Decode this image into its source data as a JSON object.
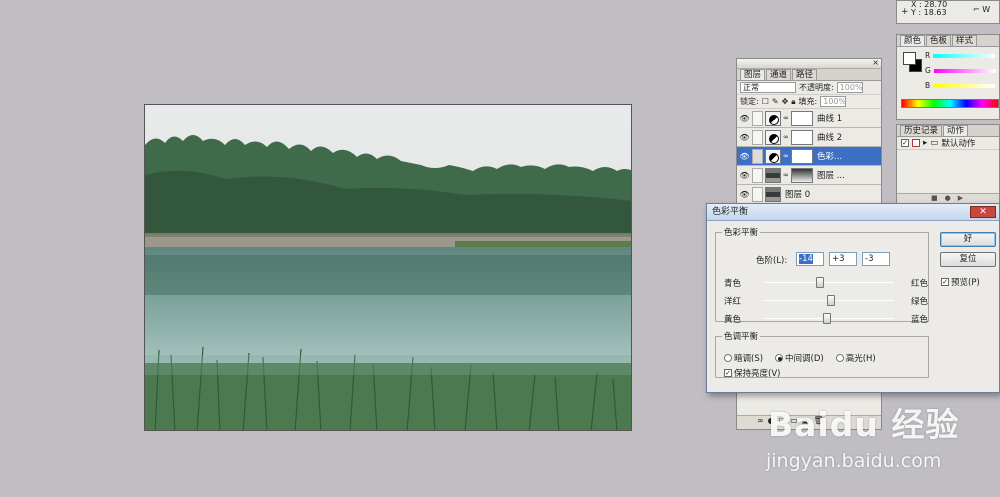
{
  "layers_panel": {
    "tabs": [
      "图层",
      "通道",
      "路径"
    ],
    "blend_mode": "正常",
    "opacity_label": "不透明度:",
    "opacity_value": "100%",
    "lock_label": "锁定:",
    "fill_label": "填充:",
    "fill_value": "100%",
    "layers": [
      {
        "name": "曲线 1",
        "kind": "adjustment",
        "selected": false
      },
      {
        "name": "曲线 2",
        "kind": "adjustment",
        "selected": false
      },
      {
        "name": "色彩...",
        "kind": "adjustment",
        "selected": true
      },
      {
        "name": "图层 ...",
        "kind": "image-mask",
        "selected": false
      },
      {
        "name": "图层 0",
        "kind": "image",
        "selected": false
      }
    ]
  },
  "info_panel": {
    "x": "X : 28.70",
    "y": "Y : 18.63"
  },
  "color_panel": {
    "tabs": [
      "颜色",
      "色板",
      "样式"
    ],
    "channels": [
      "R",
      "G",
      "B"
    ]
  },
  "actions_panel": {
    "tabs": [
      "历史记录",
      "动作"
    ],
    "default_set": "默认动作"
  },
  "dialog": {
    "title": "色彩平衡",
    "color_balance_group": "色彩平衡",
    "levels_label": "色阶(L):",
    "levels": [
      "-14",
      "+3",
      "-3"
    ],
    "sliders": [
      {
        "left": "青色",
        "right": "红色",
        "value": -14
      },
      {
        "left": "洋红",
        "right": "绿色",
        "value": 3
      },
      {
        "left": "黄色",
        "right": "蓝色",
        "value": -3
      }
    ],
    "tone_group": "色调平衡",
    "tones": [
      {
        "label": "暗调(S)",
        "checked": false
      },
      {
        "label": "中间调(D)",
        "checked": true
      },
      {
        "label": "高光(H)",
        "checked": false
      }
    ],
    "preserve_label": "保持亮度(V)",
    "preserve_checked": true,
    "ok_label": "好",
    "reset_label": "复位",
    "preview_label": "预览(P)",
    "preview_checked": true
  },
  "watermark": {
    "logo": "Baidu 经验",
    "url": "jingyan.baidu.com"
  }
}
